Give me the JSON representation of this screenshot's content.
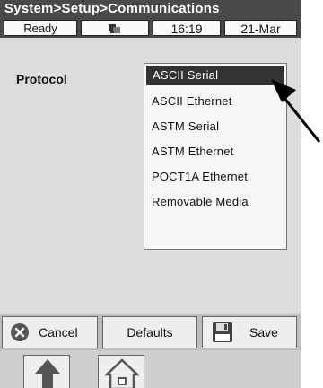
{
  "titlebar": {
    "breadcrumb": "System>Setup>Communications"
  },
  "statusbar": {
    "status": "Ready",
    "status_icon": "network-connection-icon",
    "time": "16:19",
    "date": "21-Mar"
  },
  "main": {
    "protocol_label": "Protocol",
    "protocol_options": [
      {
        "label": "ASCII Serial",
        "selected": true
      },
      {
        "label": "ASCII Ethernet",
        "selected": false
      },
      {
        "label": "ASTM Serial",
        "selected": false
      },
      {
        "label": "ASTM Ethernet",
        "selected": false
      },
      {
        "label": "POCT1A Ethernet",
        "selected": false
      },
      {
        "label": "Removable Media",
        "selected": false
      }
    ]
  },
  "buttons": {
    "cancel_label": "Cancel",
    "cancel_icon": "x-circle-icon",
    "defaults_label": "Defaults",
    "save_label": "Save",
    "save_icon": "floppy-disk-icon"
  },
  "nav": {
    "up_icon": "up-arrow-icon",
    "home_icon": "home-icon"
  },
  "colors": {
    "titlebar_bg": "#4a4a4a",
    "selected_bg": "#333333",
    "content_bg": "#dcdcdc"
  }
}
